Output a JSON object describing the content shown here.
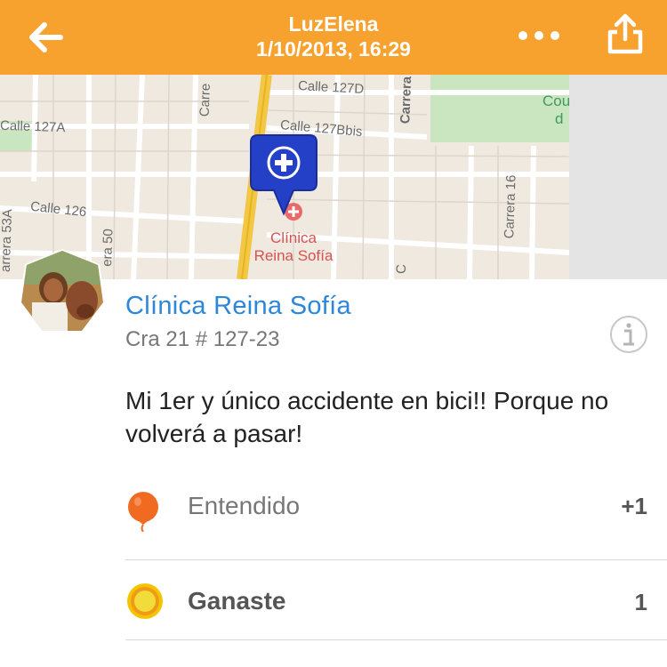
{
  "header": {
    "user": "LuzElena",
    "datetime": "1/10/2013, 16:29",
    "background": "#f7a12f"
  },
  "map": {
    "streets": {
      "calle_127d": "Calle 127D",
      "calle_127a": "Calle 127A",
      "calle_127bbis": "Calle 127Bbis",
      "calle_126": "Calle 126",
      "carrera_top": "Carre",
      "carrera_mid": "Carrera",
      "carrera_16": "Carrera 16",
      "carrera_53a": "arrera 53A",
      "carrera_50": "era 50",
      "carrera_c": "C"
    },
    "poi": {
      "line1": "Clínica",
      "line2": "Reina Sofía"
    },
    "park": {
      "line1": "Cou",
      "line2": "d"
    },
    "pin_icon": "medical-cross-icon",
    "pin_color": "#2340c6"
  },
  "checkin": {
    "venue": "Clínica Reina Sofía",
    "address": "Cra 21 # 127-23",
    "text": "Mi 1er y único accidente en bici!! Porque no volverá a pasar!",
    "accent": "#2d87d8"
  },
  "actions": [
    {
      "icon": "balloon-icon",
      "label": "Entendido",
      "count": "+1",
      "color": "#f06b21"
    },
    {
      "icon": "sun-coin-icon",
      "label": "Ganaste",
      "count": "1",
      "color": "#f5c400"
    }
  ]
}
